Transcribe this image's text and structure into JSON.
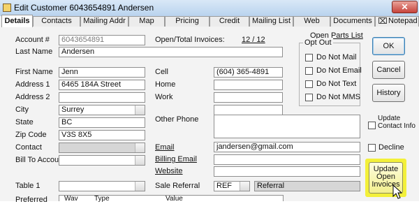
{
  "window": {
    "title": "Edit Customer 6043654891 Andersen",
    "close_glyph": "✕"
  },
  "tabs": [
    "Details",
    "Contacts",
    "Mailing Addr",
    "Map",
    "Pricing",
    "Credit",
    "Mailing List",
    "Web",
    "Documents",
    "Notepad"
  ],
  "form": {
    "account_label": "Account #",
    "account_value": "6043654891",
    "open_total_label": "Open/Total Invoices:",
    "open_total_value": "12 / 12",
    "open_parts_label": "Open Parts List",
    "last_name_label": "Last Name",
    "last_name_value": "Andersen",
    "first_name_label": "First Name",
    "first_name_value": "Jenn",
    "address1_label": "Address 1",
    "address1_value": "6465 184A Street",
    "address2_label": "Address 2",
    "address2_value": "",
    "city_label": "City",
    "city_value": "Surrey",
    "state_label": "State",
    "state_value": "BC",
    "zip_label": "Zip Code",
    "zip_value": "V3S 8X5",
    "contact_label": "Contact",
    "contact_value": "",
    "bill_to_label": "Bill To Account",
    "bill_to_value": "",
    "table1_label": "Table 1",
    "table1_value": "",
    "cell_label": "Cell",
    "cell_value": "(604) 365-4891",
    "home_label": "Home",
    "home_value": "",
    "work_label": "Work",
    "work_value": "",
    "other_phone_label": "Other Phone",
    "other_phone_value": "",
    "email_label": "Email",
    "email_value": "jandersen@gmail.com",
    "billing_email_label": "Billing Email",
    "billing_email_value": "",
    "website_label": "Website",
    "website_value": "",
    "sale_referral_label": "Sale Referral",
    "sale_referral_code": "REF",
    "sale_referral_text": "Referral",
    "preferred_label": "Preferred",
    "grid_headers": [
      "Wav",
      "Type",
      "Value"
    ]
  },
  "opt_out": {
    "title": "Opt Out",
    "items": [
      "Do Not Mail",
      "Do Not Email",
      "Do Not Text",
      "Do Not MMS"
    ]
  },
  "buttons": {
    "ok": "OK",
    "cancel": "Cancel",
    "history": "History",
    "update_open_invoices": "Update Open Invoices"
  },
  "checks": {
    "update_contact_info": "Update Contact Info",
    "decline": "Decline"
  }
}
